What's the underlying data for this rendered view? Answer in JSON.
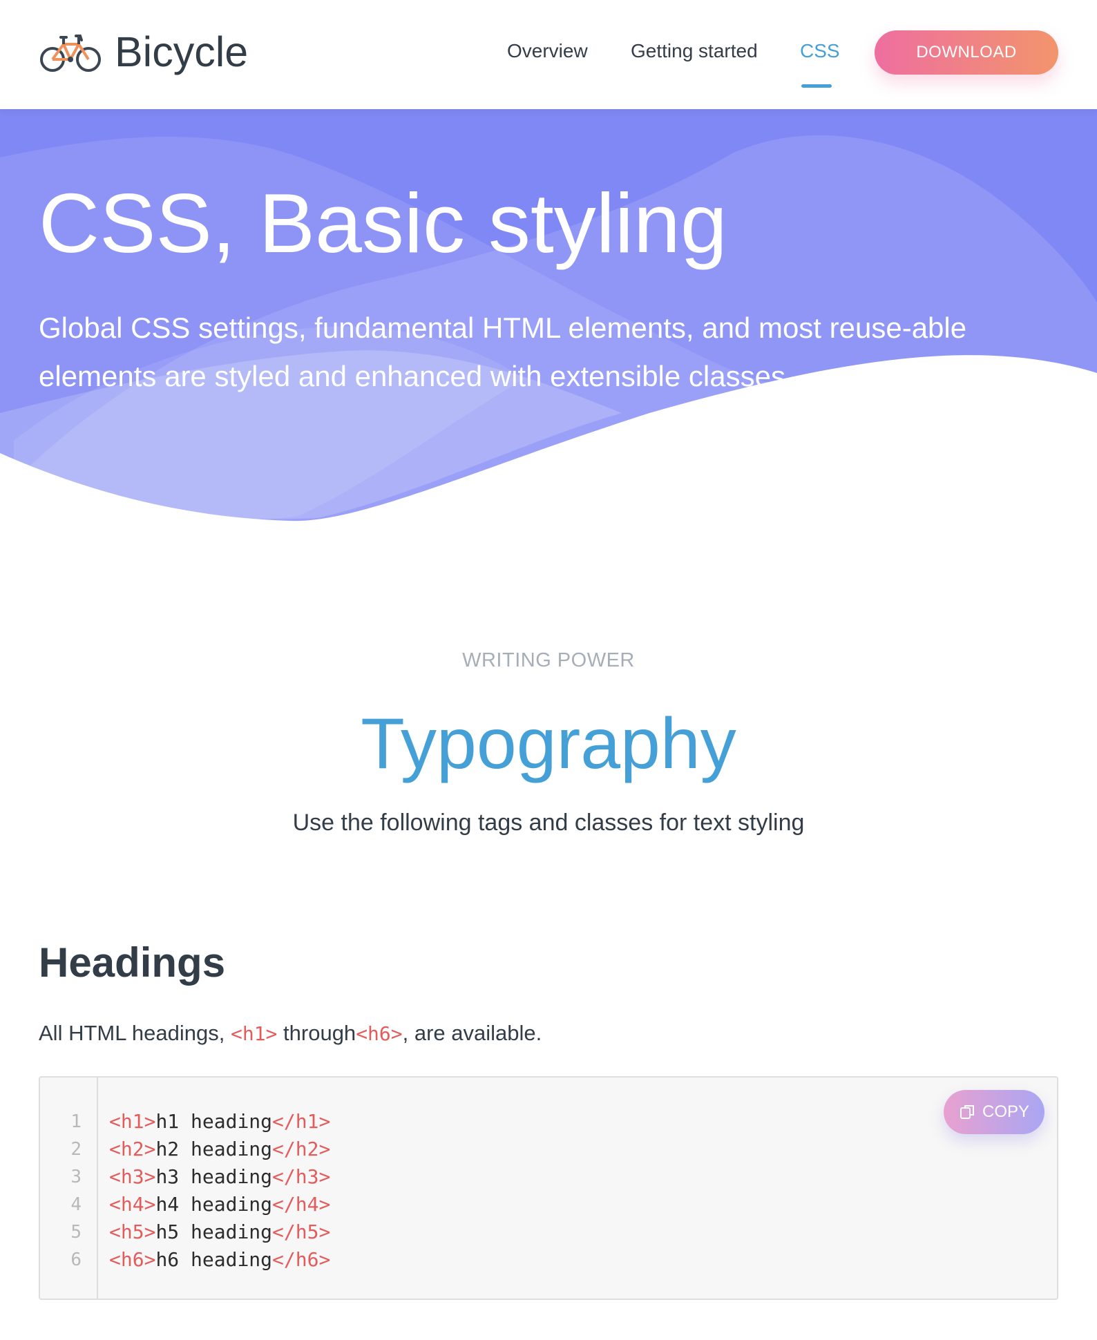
{
  "header": {
    "brand": "Bicycle",
    "nav": [
      {
        "label": "Overview",
        "active": false
      },
      {
        "label": "Getting started",
        "active": false
      },
      {
        "label": "CSS",
        "active": true
      }
    ],
    "download_label": "DOWNLOAD"
  },
  "hero": {
    "title": "CSS, Basic styling",
    "subtitle": "Global CSS settings, fundamental HTML elements, and most reuse-able elements are styled and enhanced with extensible classes."
  },
  "section": {
    "eyebrow": "WRITING POWER",
    "title": "Typography",
    "lead": "Use the following tags and classes for text styling"
  },
  "headings": {
    "title": "Headings",
    "text_before": "All HTML headings, ",
    "tag_start": "<h1>",
    "text_mid": " through",
    "tag_end": "<h6>",
    "text_after": ", are available.",
    "copy_label": "COPY",
    "code": [
      {
        "line": "1",
        "open": "<h1>",
        "text": "h1 heading",
        "close": "</h1>"
      },
      {
        "line": "2",
        "open": "<h2>",
        "text": "h2 heading",
        "close": "</h2>"
      },
      {
        "line": "3",
        "open": "<h3>",
        "text": "h3 heading",
        "close": "</h3>"
      },
      {
        "line": "4",
        "open": "<h4>",
        "text": "h4 heading",
        "close": "</h4>"
      },
      {
        "line": "5",
        "open": "<h5>",
        "text": "h5 heading",
        "close": "</h5>"
      },
      {
        "line": "6",
        "open": "<h6>",
        "text": "h6 heading",
        "close": "</h6>"
      }
    ]
  },
  "colors": {
    "accent": "#45a0d8",
    "hero": "#8088f5",
    "download_gradient": [
      "#ee6e9f",
      "#f2956c"
    ],
    "code_tag": "#e45b5b"
  },
  "icons": {
    "brand": "bicycle-icon",
    "copy": "copy-icon"
  }
}
